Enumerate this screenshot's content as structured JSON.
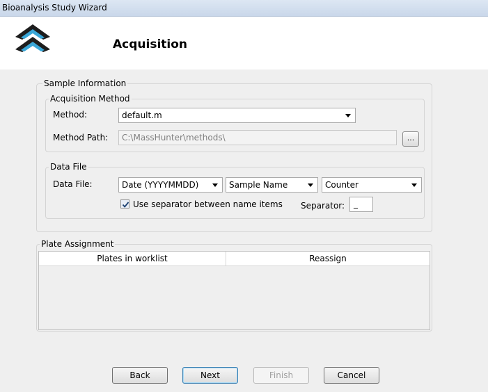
{
  "window": {
    "title": "Bioanalysis Study Wizard"
  },
  "header": {
    "title": "Acquisition",
    "logo_icon": "double-chevron-up-logo"
  },
  "sample_info": {
    "legend": "Sample Information",
    "acq_method": {
      "legend": "Acquisition Method",
      "method_label": "Method:",
      "method_value": "default.m",
      "path_label": "Method Path:",
      "path_value": "C:\\MassHunter\\methods\\",
      "browse_label": "..."
    },
    "data_file": {
      "legend": "Data File",
      "label": "Data File:",
      "combo1": "Date (YYYYMMDD)",
      "combo2": "Sample Name",
      "combo3": "Counter",
      "use_separator_label": "Use separator between name items",
      "use_separator_checked": true,
      "separator_label": "Separator:",
      "separator_value": "_"
    }
  },
  "plate_assignment": {
    "legend": "Plate Assignment",
    "columns": [
      "Plates in worklist",
      "Reassign"
    ]
  },
  "buttons": {
    "back": "Back",
    "next": "Next",
    "finish": "Finish",
    "cancel": "Cancel"
  }
}
